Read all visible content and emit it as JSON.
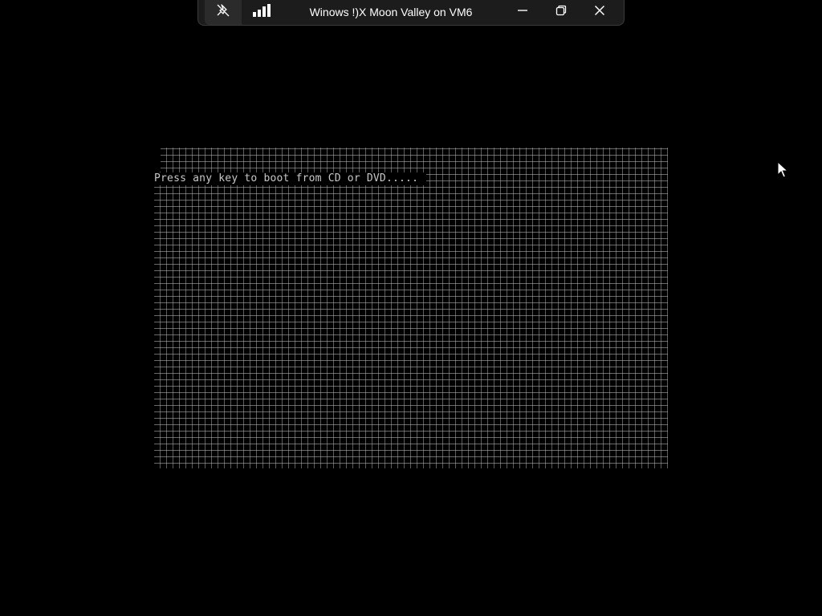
{
  "connection_bar": {
    "title": "Winows !)X Moon Valley on VM6",
    "pin_icon": "pin-off-icon",
    "signal_icon": "signal-strength-icon",
    "minimize_icon": "minimize-icon",
    "restore_icon": "restore-icon",
    "close_icon": "close-icon"
  },
  "console": {
    "boot_message": "Press any key to boot from CD or DVD.....",
    "background_color": "#000000",
    "text_color": "#c8c8c8"
  },
  "cursor": {
    "icon": "arrow-cursor-icon"
  }
}
